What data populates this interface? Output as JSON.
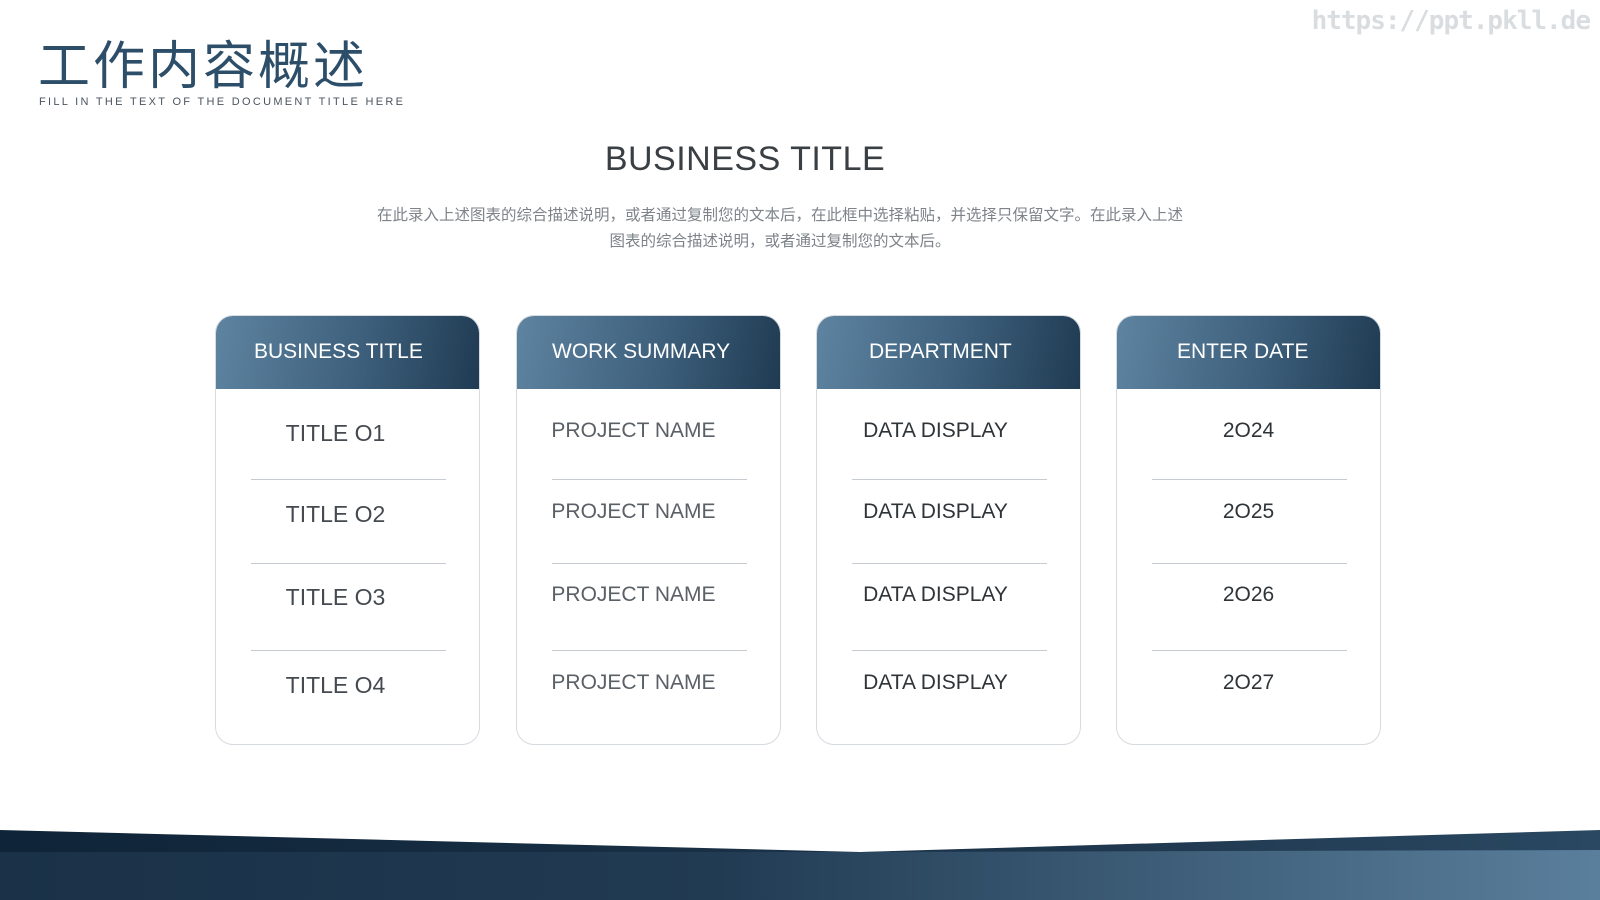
{
  "header": {
    "title": "工作内容概述",
    "subtitle": "FILL IN THE TEXT OF THE DOCUMENT TITLE HERE",
    "watermark": "https://ppt.pkll.de"
  },
  "section": {
    "title": "BUSINESS TITLE",
    "description": "在此录入上述图表的综合描述说明，或者通过复制您的文本后，在此框中选择粘贴，并选择只保留文字。在此录入上述图表的综合描述说明，或者通过复制您的文本后。"
  },
  "cards": [
    {
      "header": "BUSINESS TITLE",
      "rows": [
        "TITLE O1",
        "TITLE O2",
        "TITLE O3",
        "TITLE O4"
      ]
    },
    {
      "header": "WORK SUMMARY",
      "rows": [
        "PROJECT NAME",
        "PROJECT NAME",
        "PROJECT NAME",
        "PROJECT NAME"
      ]
    },
    {
      "header": "DEPARTMENT",
      "rows": [
        "DATA DISPLAY",
        "DATA DISPLAY",
        "DATA DISPLAY",
        "DATA DISPLAY"
      ]
    },
    {
      "header": "ENTER DATE",
      "rows": [
        "2O24",
        "2O25",
        "2O26",
        "2O27"
      ]
    }
  ],
  "colors": {
    "accent_light": "#5e84a1",
    "accent_dark": "#1f3a52",
    "title_text": "#2c4e69"
  }
}
